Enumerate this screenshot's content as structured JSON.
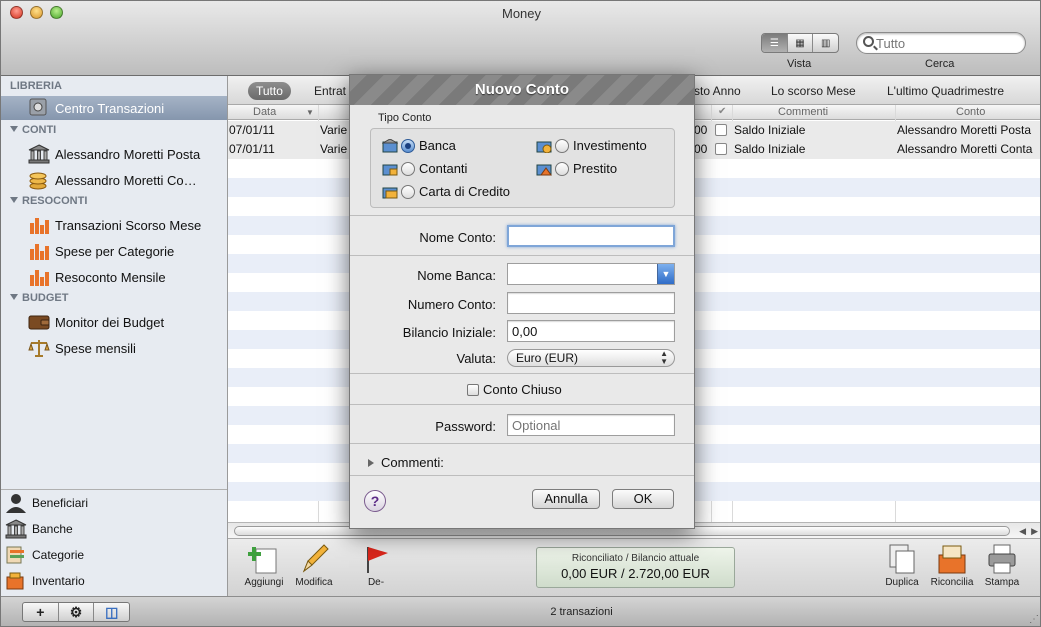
{
  "window": {
    "title": "Money"
  },
  "toolbar": {
    "view_label": "Vista",
    "search_label": "Cerca",
    "search_value": "Tutto"
  },
  "sidebar": {
    "groups": {
      "libreria": "LIBRERIA",
      "conti": "CONTI",
      "resoconti": "RESOCONTI",
      "budget": "BUDGET"
    },
    "items": {
      "centro": "Centro Transazioni",
      "conto1": "Alessandro Moretti Posta",
      "conto2": "Alessandro Moretti Co…",
      "res1": "Transazioni Scorso Mese",
      "res2": "Spese per Categorie",
      "res3": "Resoconto Mensile",
      "bud1": "Monitor dei Budget",
      "bud2": "Spese mensili"
    },
    "bottom": {
      "beneficiari": "Beneficiari",
      "banche": "Banche",
      "categorie": "Categorie",
      "inventario": "Inventario"
    }
  },
  "filters": {
    "tutto": "Tutto",
    "entrate": "Entrat",
    "anno": "sto Anno",
    "mese": "Lo scorso Mese",
    "quad": "L'ultimo Quadrimestre"
  },
  "table": {
    "headers": {
      "data": "Data",
      "commenti": "Commenti",
      "conto": "Conto"
    },
    "rows": [
      {
        "date": "07/01/11",
        "desc": "Varie",
        "amount": "00",
        "comment": "Saldo Iniziale",
        "account": "Alessandro Moretti Posta"
      },
      {
        "date": "07/01/11",
        "desc": "Varie",
        "amount": "00",
        "comment": "Saldo Iniziale",
        "account": "Alessandro Moretti Conta"
      }
    ]
  },
  "actions": {
    "aggiungi": "Aggiungi",
    "modifica": "Modifica",
    "de": "De-",
    "duplica": "Duplica",
    "riconcilia": "Riconcilia",
    "stampa": "Stampa"
  },
  "balance": {
    "label": "Riconciliato / Bilancio attuale",
    "value": "0,00 EUR / 2.720,00 EUR"
  },
  "status": {
    "text": "2 transazioni"
  },
  "dialog": {
    "title": "Nuovo Conto",
    "tipo_label": "Tipo Conto",
    "types": {
      "banca": "Banca",
      "investimento": "Investimento",
      "contanti": "Contanti",
      "prestito": "Prestito",
      "carta": "Carta di Credito"
    },
    "nome_conto_label": "Nome Conto:",
    "nome_conto_value": "",
    "nome_banca_label": "Nome Banca:",
    "nome_banca_value": "",
    "numero_conto_label": "Numero Conto:",
    "numero_conto_value": "",
    "bilancio_label": "Bilancio Iniziale:",
    "bilancio_value": "0,00",
    "valuta_label": "Valuta:",
    "valuta_value": "Euro (EUR)",
    "chiuso_label": "Conto Chiuso",
    "password_label": "Password:",
    "password_placeholder": "Optional",
    "commenti_label": "Commenti:",
    "help": "?",
    "annulla": "Annulla",
    "ok": "OK"
  }
}
